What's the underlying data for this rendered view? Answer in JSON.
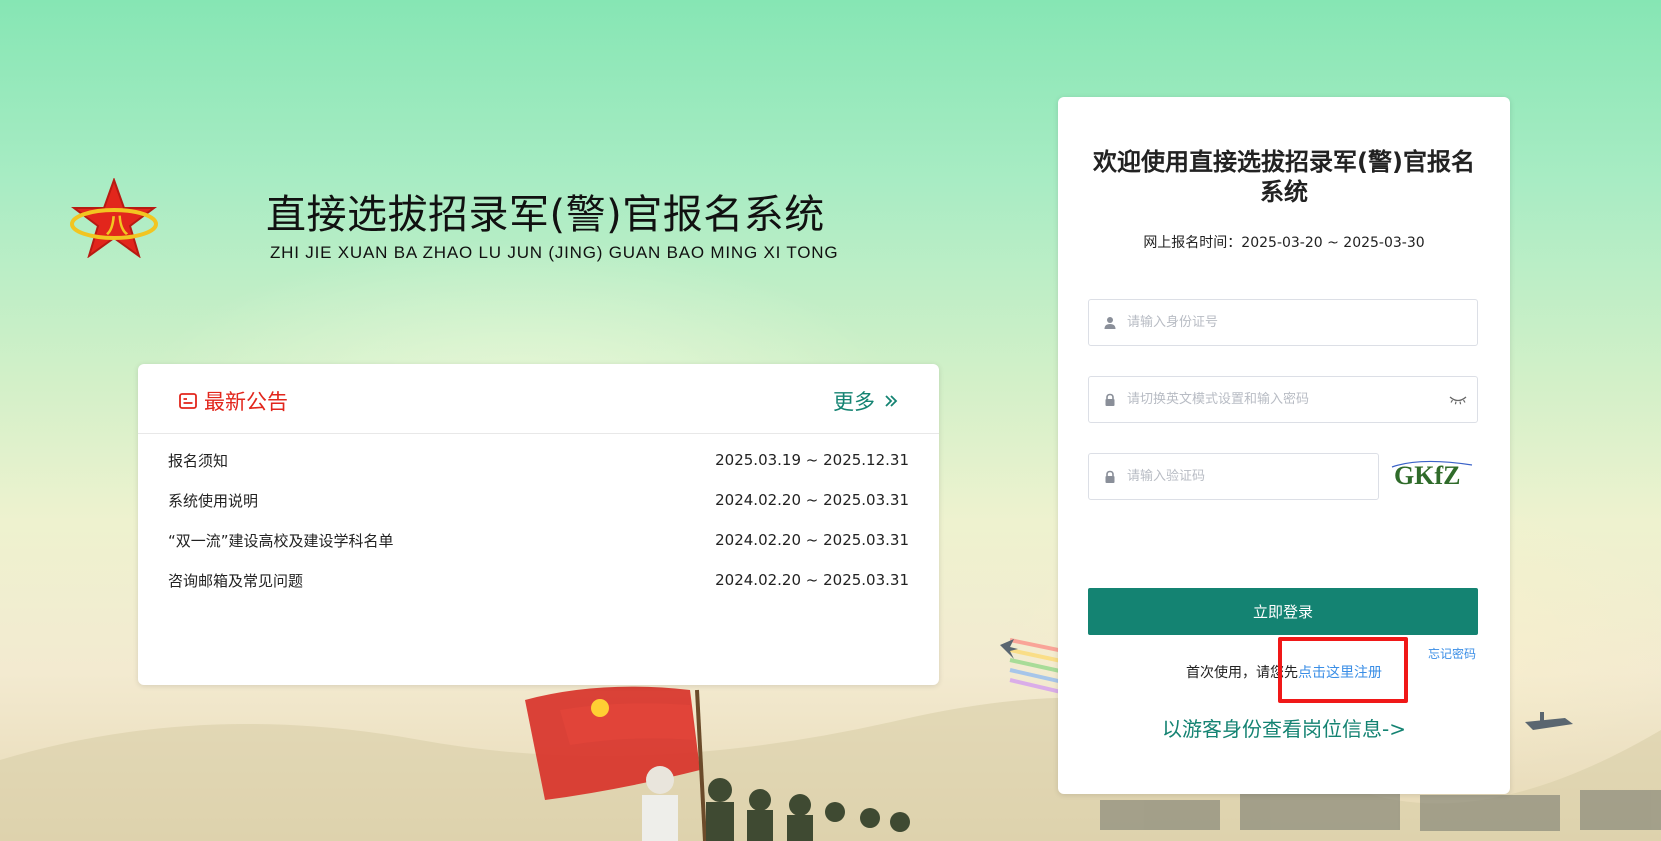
{
  "header": {
    "title": "直接选拔招录军(警)官报名系统",
    "subtitle": "ZHI JIE XUAN BA ZHAO LU JUN (JING) GUAN BAO MING XI TONG"
  },
  "notice": {
    "title": "最新公告",
    "more_label": "更多",
    "items": [
      {
        "label": "报名须知",
        "date": "2025.03.19 ~ 2025.12.31"
      },
      {
        "label": "系统使用说明",
        "date": "2024.02.20 ~ 2025.03.31"
      },
      {
        "label": "“双一流”建设高校及建设学科名单",
        "date": "2024.02.20 ~ 2025.03.31"
      },
      {
        "label": "咨询邮箱及常见问题",
        "date": "2024.02.20 ~ 2025.03.31"
      }
    ]
  },
  "login": {
    "title": "欢迎使用直接选拔招录军(警)官报名系统",
    "time_label": "网上报名时间：2025-03-20 ~ 2025-03-30",
    "id_placeholder": "请输入身份证号",
    "password_placeholder": "请切换英文模式设置和输入密码",
    "captcha_placeholder": "请输入验证码",
    "captcha_text": "GKfZ",
    "login_button": "立即登录",
    "forgot_password": "忘记密码",
    "first_use_prefix": "首次使用，请您先",
    "register_link": "点击这里注册",
    "guest_link": "以游客身份查看岗位信息->"
  },
  "colors": {
    "accent": "#148372",
    "notice_red": "#e2261c",
    "link_blue": "#3a8ee6",
    "highlight_red": "#f01818"
  },
  "icons": {
    "logo": "red-star-emblem-icon",
    "notice": "notice-card-icon",
    "more": "double-chevron-right-icon",
    "id": "user-icon",
    "password": "lock-icon",
    "captcha": "lock-icon",
    "toggle": "eye-closed-icon"
  }
}
